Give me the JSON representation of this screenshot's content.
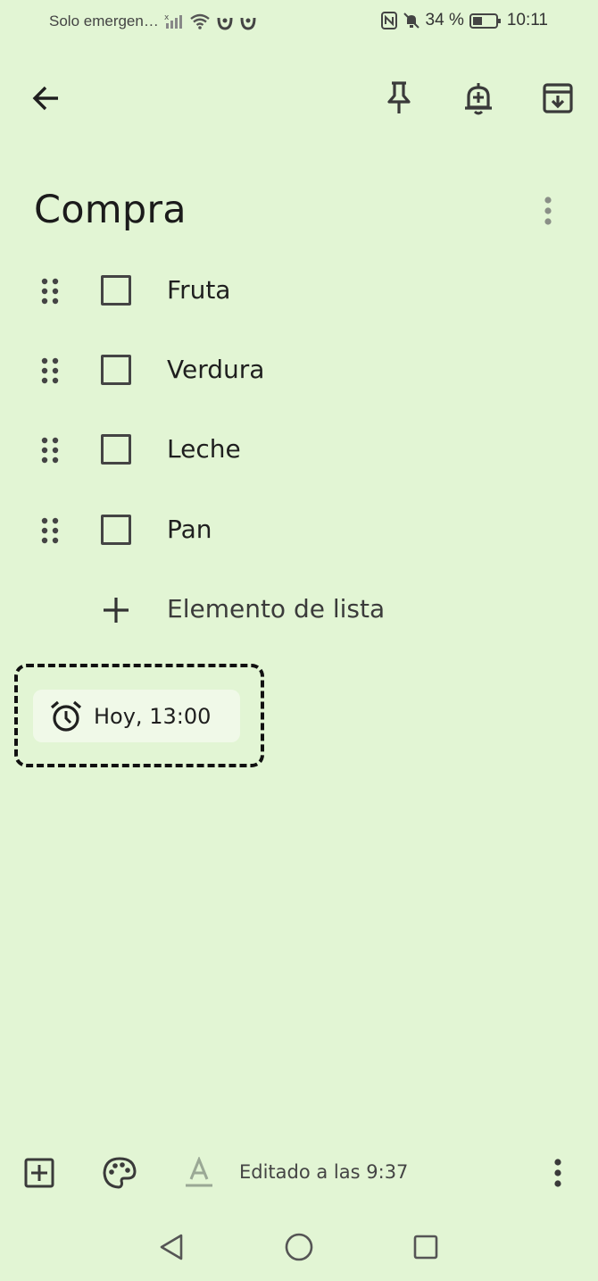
{
  "status_bar": {
    "carrier": "Solo emergen…",
    "battery": "34 %",
    "time": "10:11"
  },
  "toolbar": {
    "back_icon": "arrow-back-icon",
    "pin_icon": "pin-icon",
    "reminder_icon": "add-alert-icon",
    "archive_icon": "archive-icon"
  },
  "note": {
    "title": "Compra",
    "items": [
      {
        "label": "Fruta",
        "checked": false
      },
      {
        "label": "Verdura",
        "checked": false
      },
      {
        "label": "Leche",
        "checked": false
      },
      {
        "label": "Pan",
        "checked": false
      }
    ],
    "add_item_label": "Elemento de lista",
    "reminder": "Hoy, 13:00"
  },
  "bottom_bar": {
    "edited": "Editado a las 9:37"
  },
  "colors": {
    "background": "#e2f5d4",
    "chip": "#f0f9e8"
  }
}
